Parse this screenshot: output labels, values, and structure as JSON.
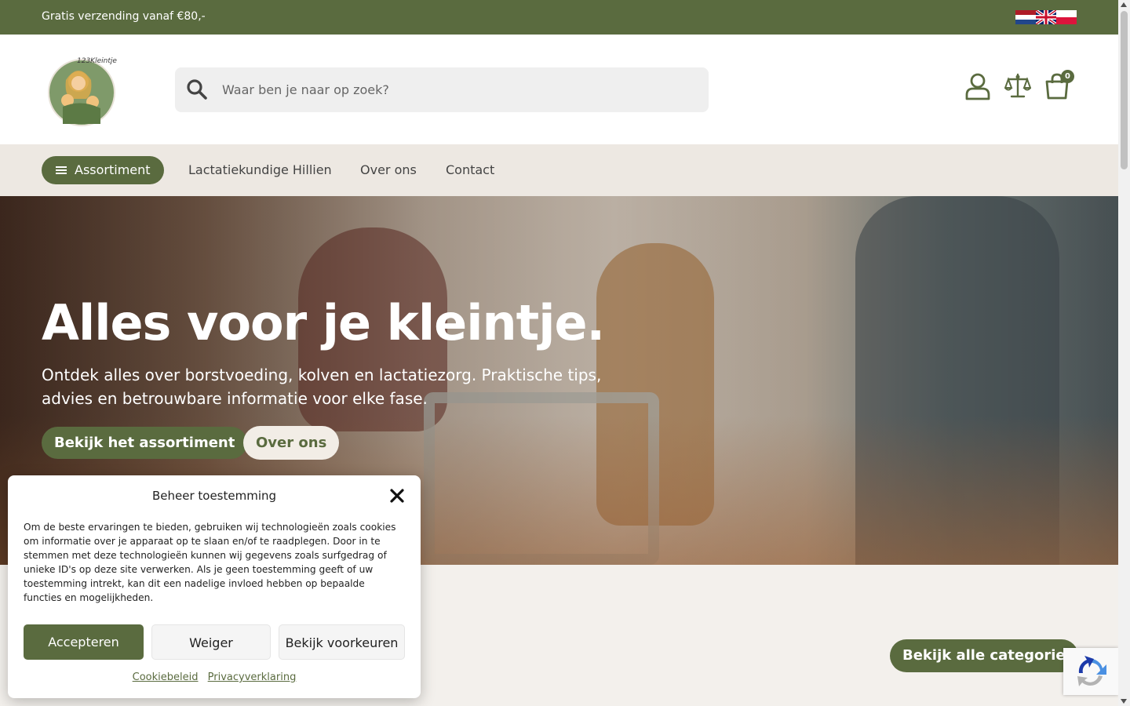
{
  "topbar": {
    "promo": "Gratis verzending vanaf €80,-",
    "languages": [
      "nl-flag-icon",
      "uk-flag-icon",
      "pl-flag-icon"
    ]
  },
  "header": {
    "logo_text": "123Kleintje",
    "search_placeholder": "Waar ben je naar op zoek?",
    "cart_count": "0"
  },
  "nav": {
    "assortment": "Assortiment",
    "links": [
      "Lactatiekundige Hillien",
      "Over ons",
      "Contact"
    ]
  },
  "hero": {
    "title": "Alles voor je kleintje.",
    "subtitle": "Ontdek alles over borstvoeding, kolven en lactatiezorg. Praktische tips, advies en betrouwbare informatie voor elke fase.",
    "primary_button": "Bekijk het assortiment",
    "secondary_button": "Over ons"
  },
  "section": {
    "categories_button": "Bekijk alle categorieen"
  },
  "consent": {
    "title": "Beheer toestemming",
    "body": "Om de beste ervaringen te bieden, gebruiken wij technologieën zoals cookies om informatie over je apparaat op te slaan en/of te raadplegen. Door in te stemmen met deze technologieën kunnen wij gegevens zoals surfgedrag of unieke ID's op deze site verwerken. Als je geen toestemming geeft of uw toestemming intrekt, kan dit een nadelige invloed hebben op bepaalde functies en mogelijkheden.",
    "accept": "Accepteren",
    "deny": "Weiger",
    "preferences": "Bekijk voorkeuren",
    "cookie_policy": "Cookiebeleid",
    "privacy": "Privacyverklaring"
  },
  "colors": {
    "brand_green": "#5a6b3f",
    "nav_bg": "#ede8e2"
  }
}
